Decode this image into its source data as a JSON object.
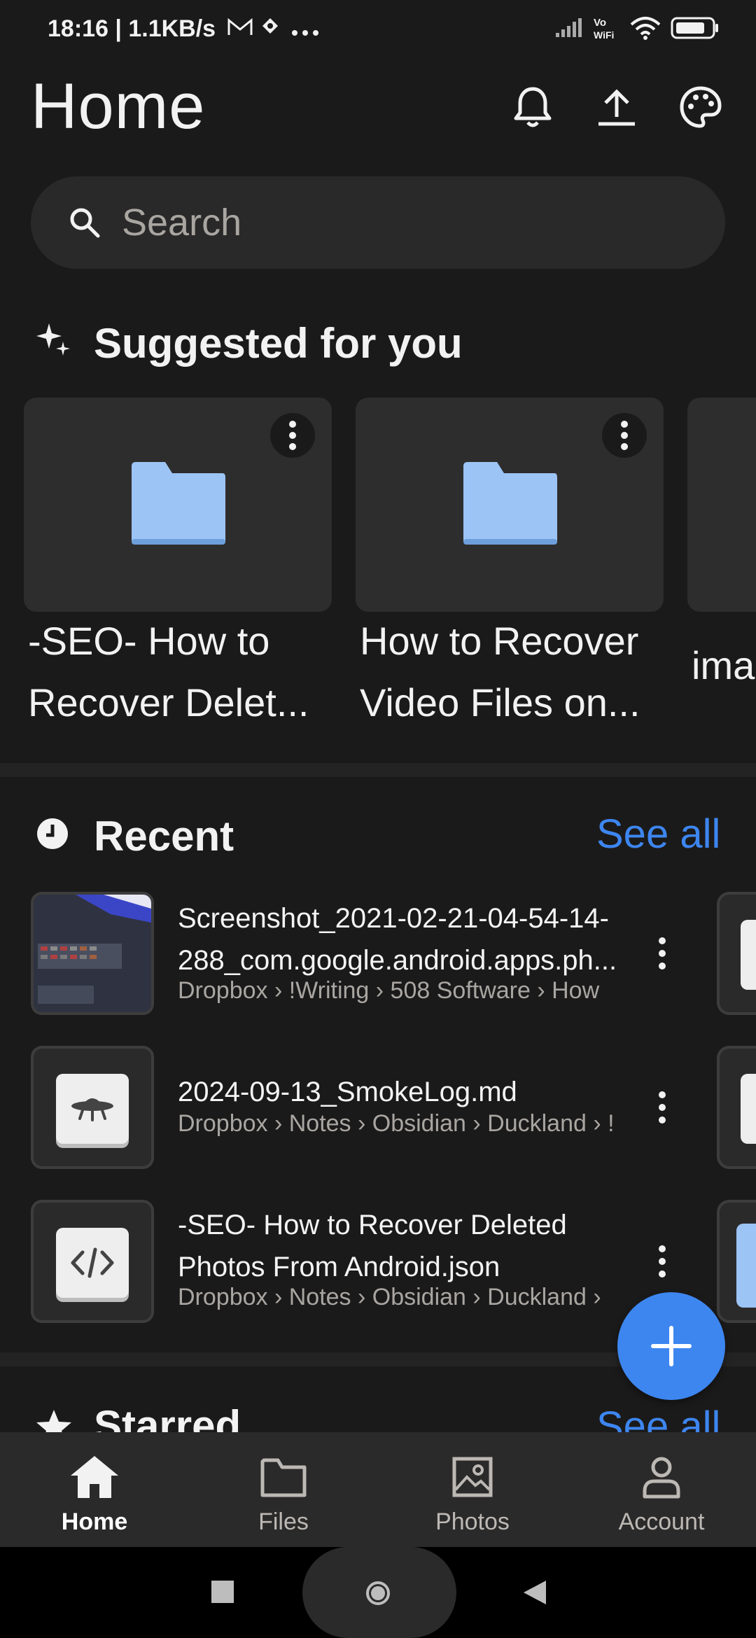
{
  "status_bar": {
    "time": "18:16 | 1.1KB/s",
    "icons": [
      "gmail-icon",
      "app-icon",
      "more-dots-icon",
      "signal-icon",
      "vowifi-icon",
      "wifi-icon",
      "battery-icon"
    ]
  },
  "header": {
    "title": "Home",
    "icons": [
      "bell-icon",
      "upload-icon",
      "palette-icon"
    ]
  },
  "search": {
    "placeholder": "Search"
  },
  "suggested": {
    "title": "Suggested for you",
    "cards": [
      {
        "line1": "-SEO- How to",
        "line2": "Recover Delet..."
      },
      {
        "line1": "How to Recover",
        "line2": "Video Files on..."
      },
      {
        "line1": "ima"
      }
    ]
  },
  "recent": {
    "title": "Recent",
    "see_all": "See all",
    "items": [
      {
        "title1": "Screenshot_2021-02-21-04-54-14-",
        "title2": "288_com.google.android.apps.ph...",
        "path": "Dropbox › !Writing › 508 Software › How"
      },
      {
        "title1": "2024-09-13_SmokeLog.md",
        "path": "Dropbox › Notes › Obsidian › Duckland › !"
      },
      {
        "title1": "-SEO- How to Recover Deleted",
        "title2": "Photos From Android.json",
        "path": "Dropbox › Notes › Obsidian › Duckland ›"
      }
    ]
  },
  "starred": {
    "title": "Starred",
    "see_all": "See all"
  },
  "bottom_nav": [
    {
      "label": "Home",
      "icon": "home-icon",
      "active": true
    },
    {
      "label": "Files",
      "icon": "folder-icon",
      "active": false
    },
    {
      "label": "Photos",
      "icon": "photo-icon",
      "active": false
    },
    {
      "label": "Account",
      "icon": "account-icon",
      "active": false
    }
  ],
  "colors": {
    "accent": "#3d86f0",
    "background": "#1b1a1a",
    "folder": "#9cc4f5"
  }
}
